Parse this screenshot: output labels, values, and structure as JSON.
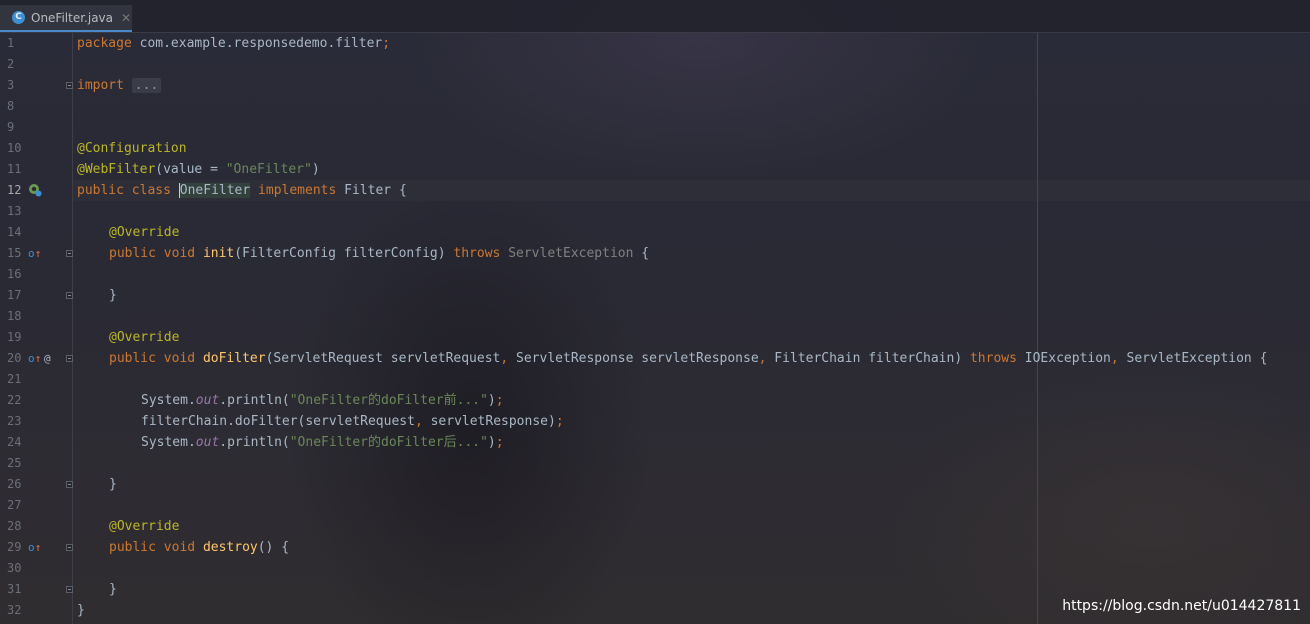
{
  "tab": {
    "filename": "OneFilter.java",
    "icon_letter": "C",
    "close_icon": "close-icon"
  },
  "current_line": 12,
  "line_numbers": [
    "1",
    "2",
    "3",
    "8",
    "9",
    "10",
    "11",
    "12",
    "13",
    "14",
    "15",
    "16",
    "17",
    "18",
    "19",
    "20",
    "21",
    "22",
    "23",
    "24",
    "25",
    "26",
    "27",
    "28",
    "29",
    "30",
    "31",
    "32"
  ],
  "code": {
    "pkg_kw": "package",
    "pkg_name": "com.example.responsedemo.filter",
    "pkg_semi": ";",
    "import_kw": "import",
    "import_folded": "...",
    "ann_config": "@Configuration",
    "ann_webfilter": "@WebFilter",
    "webfilter_open": "(value = ",
    "webfilter_value": "\"OneFilter\"",
    "webfilter_close": ")",
    "cls_public": "public",
    "cls_class": "class",
    "cls_name": "OneFilter",
    "cls_implements": "implements",
    "cls_iface": "Filter {",
    "override": "@Override",
    "m_public": "public",
    "m_void": "void",
    "init_name": "init",
    "init_params": "(FilterConfig filterConfig) ",
    "throws": "throws",
    "init_exc": "ServletException",
    "open_brace": " {",
    "close_brace": "}",
    "dofilter_name": "doFilter",
    "dofilter_p1": "(ServletRequest servletRequest",
    "comma": ",",
    "dofilter_p2": " ServletResponse servletResponse",
    "dofilter_p3": " FilterChain filterChain) ",
    "exc_io": "IOException",
    "exc_servlet": " ServletException {",
    "sys": "System.",
    "out": "out",
    "println": ".println(",
    "str_before": "\"OneFilter的doFilter前...\"",
    "str_after": "\"OneFilter的doFilter后...\"",
    "paren_close": ")",
    "semi": ";",
    "chain_call": "filterChain.doFilter(servletRequest",
    "chain_args": " servletResponse)",
    "destroy_name": "destroy",
    "destroy_parens": "() {"
  },
  "watermark": "https://blog.csdn.net/u014427811"
}
